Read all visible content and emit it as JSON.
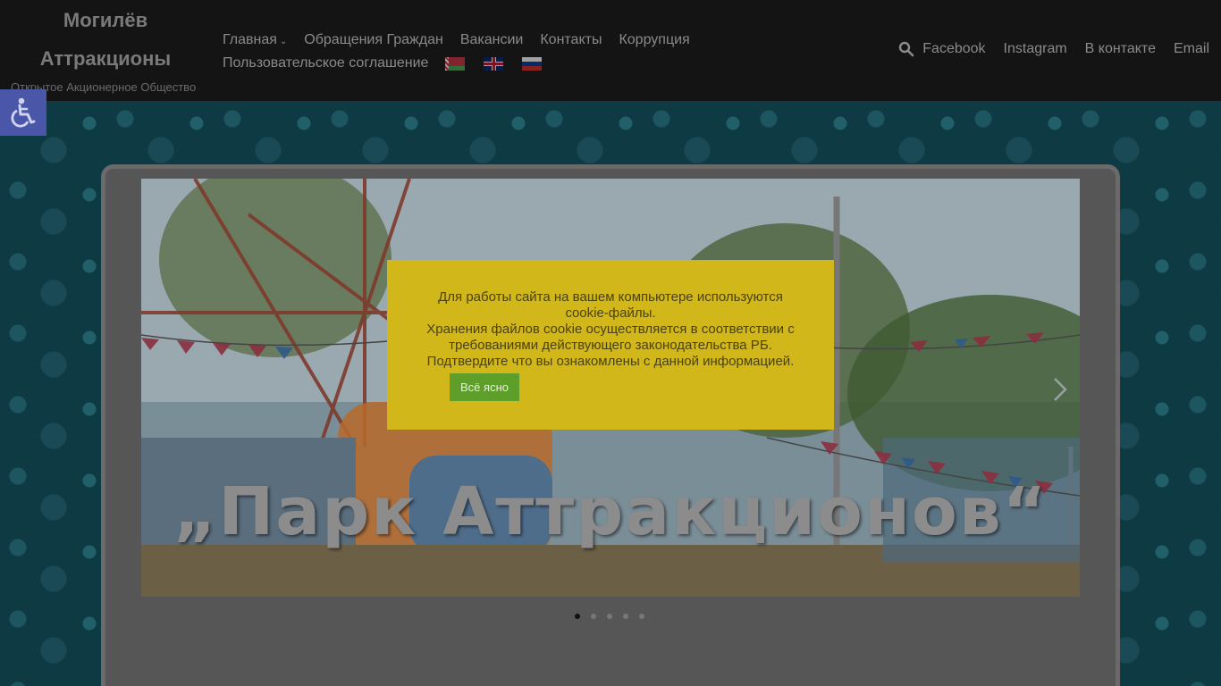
{
  "site": {
    "title_line1": "Могилёв",
    "title_line2": "Аттракционы",
    "subtitle": "Открытое Акционерное Общество"
  },
  "nav": {
    "row1": [
      "Главная",
      "Обращения Граждан",
      "Вакансии",
      "Контакты",
      "Коррупция"
    ],
    "row2": [
      "Пользовательское соглашение"
    ],
    "languages": [
      "by-flag",
      "gb-flag",
      "ru-flag"
    ]
  },
  "social": {
    "search_icon": "search-icon",
    "links": [
      "Facebook",
      "Instagram",
      "В контакте",
      "Email"
    ]
  },
  "accessibility": {
    "icon": "wheelchair-icon"
  },
  "slider": {
    "caption": "„Парк Аттракционов“",
    "dots_count": 5,
    "active_dot": 1
  },
  "cookie": {
    "line1": "Для работы сайта на вашем компьютере используются",
    "line2": "cookie-файлы.",
    "line3": "Хранения файлов cookie осуществляется в соответствии с",
    "line4": "требованиями действующего законодательства РБ.",
    "line5": "Подтвердите что вы ознакомлены с данной информацией.",
    "button_label": "Всё ясно"
  },
  "colors": {
    "header_bg": "#141414",
    "cookie_bg": "#d2b71a",
    "cookie_button": "#5e9e2a",
    "a11y_bg": "#4a56a8"
  }
}
